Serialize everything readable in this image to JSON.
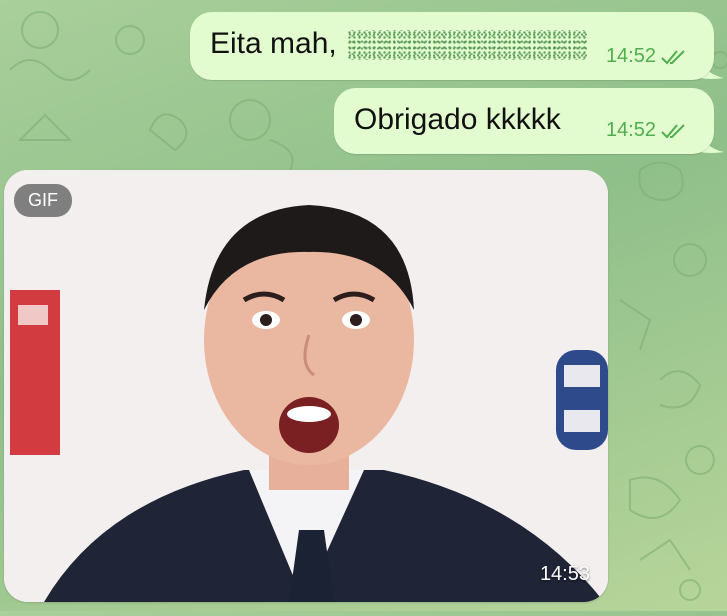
{
  "chat": {
    "messages": [
      {
        "text": "Eita mah,",
        "has_spoiler": true,
        "time": "14:52",
        "status": "read"
      },
      {
        "text": "Obrigado kkkkk",
        "time": "14:52",
        "status": "read"
      }
    ],
    "gif": {
      "badge": "GIF",
      "time": "14:53"
    }
  },
  "colors": {
    "outgoing_bubble": "#e3fccf",
    "meta_green": "#4fae4e",
    "wallpaper": "#a9cf9a"
  },
  "icons": [
    "double-check-icon"
  ]
}
